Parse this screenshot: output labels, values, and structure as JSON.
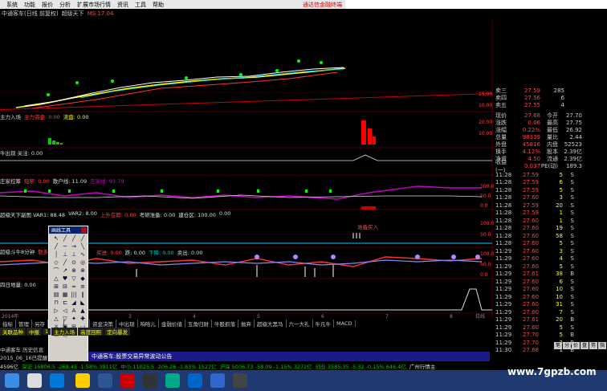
{
  "menu": [
    "系统",
    "功能",
    "报价",
    "分析",
    "扩展市场行情",
    "资讯",
    "工具",
    "帮助"
  ],
  "brand": "通达信金融终端",
  "title": {
    "name": "中通客车(日线 前复权)",
    "ind": "超级天下",
    "ma": "MS 17.04"
  },
  "axis": {
    "main": [
      "15.00",
      "10.00"
    ],
    "vol": [
      "20.00",
      "10.00"
    ],
    "zj": [
      "100.0",
      "50.0",
      "0.0"
    ],
    "nlh": [
      "100.0",
      "50.0"
    ],
    "zl": [
      "100.0",
      "50.0",
      "0.0"
    ]
  },
  "indicators": {
    "i1": [
      "主力入场",
      "主力资金: 0.00",
      "流盘: 0.00"
    ],
    "i2": [
      "牛出现 关注: 0.00"
    ],
    "i3": [
      "庄家控筹",
      "短帮: 0.00",
      "散户线: 11.09",
      "庄家线: 93.79"
    ],
    "i4": [
      "超级天下副图 VAR1: 88.48",
      "VAR2: 8.00",
      "上升在即: 0.00",
      "考研准备: 0.00",
      "建仓区: 100.00",
      "0.00"
    ],
    "i5": [
      "超级斗牛8分钟",
      "散多线",
      ""
    ],
    "i6": [
      "买进: 0.00",
      "跌: 0.00",
      "下降: 0.00",
      "卖出: 0.00"
    ],
    "i7": [
      "四日地量: 0.00"
    ],
    "ann": "准备买入"
  },
  "panel": {
    "quotes": [
      [
        "卖三",
        "27.59",
        "285"
      ],
      [
        "卖四",
        "27.56",
        "6"
      ],
      [
        "卖五",
        "27.55",
        "4"
      ]
    ],
    "stats": [
      [
        "现价",
        "27.68",
        "今开",
        "27.70"
      ],
      [
        "涨跌",
        "0.06",
        "最高",
        "27.75"
      ],
      [
        "涨幅",
        "0.22%",
        "最低",
        "26.92"
      ],
      [
        "总量",
        "98339",
        "量比",
        "2.44"
      ],
      [
        "外盘",
        "45816",
        "内盘",
        "52523"
      ],
      [
        "换手",
        "4.12%",
        "股本",
        "2.39亿"
      ],
      [
        "净资",
        "4.50",
        "流通",
        "2.39亿"
      ],
      [
        "收益(一)",
        "0.037",
        "PE(动)",
        "189.3"
      ]
    ],
    "trades": [
      [
        "11:28",
        "27.59",
        "5"
      ],
      [
        "11:28",
        "27.59",
        "6"
      ],
      [
        "11:28",
        "27.59",
        "5"
      ],
      [
        "11:28",
        "27.60",
        "3"
      ],
      [
        "11:28",
        "27.59",
        "20"
      ],
      [
        "11:28",
        "27.59",
        "1"
      ],
      [
        "11:28",
        "27.60",
        "1"
      ],
      [
        "11:28",
        "27.60",
        "19"
      ],
      [
        "11:28",
        "27.60",
        "58"
      ],
      [
        "11:28",
        "27.60",
        "5"
      ],
      [
        "11:29",
        "27.60",
        "3"
      ],
      [
        "11:29",
        "27.60",
        "4"
      ],
      [
        "11:29",
        "27.60",
        "5"
      ],
      [
        "11:29",
        "27.61",
        "38"
      ],
      [
        "11:29",
        "27.60",
        "6"
      ],
      [
        "11:29",
        "27.60",
        "10"
      ],
      [
        "11:29",
        "27.60",
        "10"
      ],
      [
        "11:29",
        "27.60",
        "31"
      ],
      [
        "11:29",
        "27.60",
        "7"
      ],
      [
        "11:29",
        "27.61",
        "20"
      ],
      [
        "11:29",
        "27.60",
        "5"
      ],
      [
        "11:29",
        "27.70",
        "5"
      ],
      [
        "11:29",
        "27.70",
        "3"
      ],
      [
        "11:30",
        "27.68",
        "1"
      ]
    ]
  },
  "tabs": [
    "指标",
    "管理",
    "另存",
    "模版",
    "STP决策",
    "资金决策",
    "中出现",
    "响哈儿",
    "金融价值",
    "五角归财",
    "牛股抓落",
    "抛弃",
    "超级大黑马",
    "六一大礼",
    "牛凡牛",
    "MACD"
  ],
  "tabs2": [
    "关联品种",
    "中报",
    "1",
    "主力入场",
    "高度回照",
    "定向暴发"
  ],
  "axis_dates": [
    "2014年",
    "12",
    "3",
    "4",
    "5",
    "6",
    "7",
    "8",
    "日线"
  ],
  "tools_title": "画线工具",
  "tool_glyphs": [
    "↖",
    "╱",
    "╱",
    "╱",
    "╱",
    "─",
    "→",
    "╲",
    "│",
    "⊥",
    "⊥",
    "∿",
    "◇",
    "╱",
    "⊙",
    "◎",
    "⌒",
    "↗",
    "⊗",
    "⊗",
    "△",
    "♥",
    "▽",
    "◆",
    "⊞",
    "⊟",
    "═",
    "≡",
    "▤",
    "▦",
    "|||",
    "‖",
    "⊓",
    "⊏",
    "◢",
    "◣",
    "▷",
    "◁",
    "A",
    "▲",
    "△",
    "▽",
    "✦",
    "✚",
    "✕",
    "▣",
    "⊞",
    "▭",
    "▭",
    "⎘"
  ],
  "statusbar": [
    {
      "t": "4596亿",
      "c": "w"
    },
    {
      "t": "深证 16806.5 -268.45 -1.58% 3911亿",
      "c": "g"
    },
    {
      "t": "中小 11025.5 -206.26 -1.83% 1527亿",
      "c": "g"
    },
    {
      "t": "沪深 5006.73 -58.09 -1.15% 3272亿",
      "c": "g"
    },
    {
      "t": "创业 3585.35 -5.32 -0.15% 646.4亿",
      "c": "g"
    },
    {
      "t": "广州行情主",
      "c": "w"
    }
  ],
  "news": "中通客车:股票交易异常波动公告",
  "left_txt": [
    "中通客车 历史信息",
    "2015_06_16已提醒"
  ],
  "watermark": "www.7gpzb.com",
  "rbtns": [
    "笔",
    "分",
    "价",
    "盘",
    "势",
    "指",
    "联"
  ]
}
